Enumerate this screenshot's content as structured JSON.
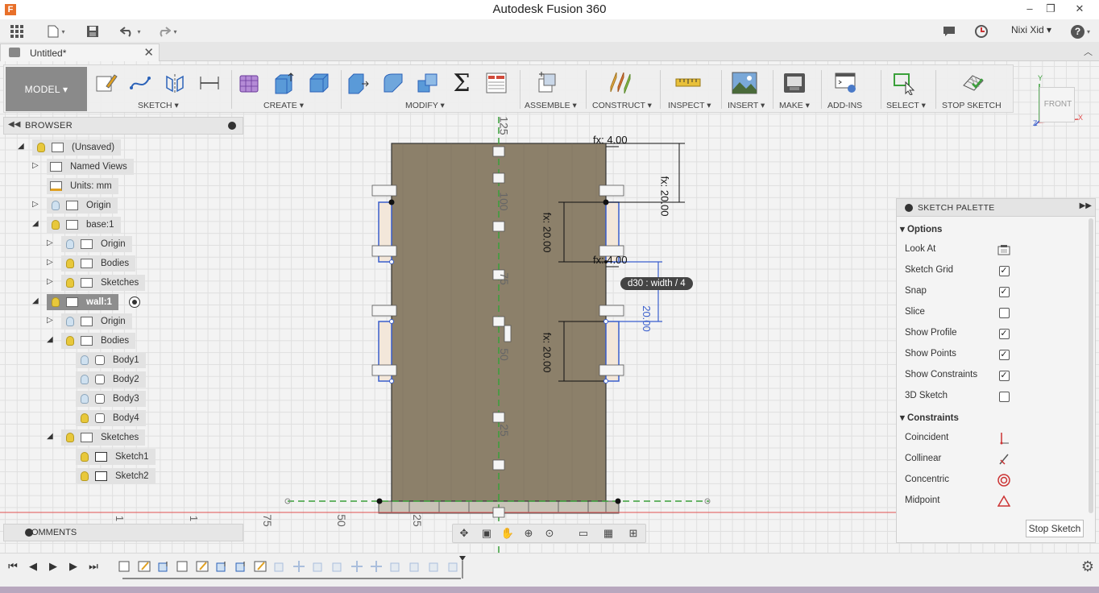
{
  "window": {
    "title": "Autodesk Fusion 360",
    "app_icon": "F",
    "minimize": "–",
    "maximize": "❐",
    "close": "✕"
  },
  "quick_access": {
    "grid_icon": "data-panel-icon",
    "file_icon": "file-icon",
    "save_icon": "save-icon",
    "undo_icon": "undo-icon",
    "redo_icon": "redo-icon",
    "user_name": "Nixi Xid",
    "caret": "▾",
    "help": "?"
  },
  "document_tab": {
    "label": "Untitled*",
    "close": "✕"
  },
  "toolbar": {
    "workspace": "MODEL ▾",
    "groups": [
      {
        "label": "SKETCH ▾"
      },
      {
        "label": "CREATE ▾"
      },
      {
        "label": "MODIFY ▾"
      },
      {
        "label": "ASSEMBLE ▾"
      },
      {
        "label": "CONSTRUCT ▾"
      },
      {
        "label": "INSPECT ▾"
      },
      {
        "label": "INSERT ▾"
      },
      {
        "label": "MAKE ▾"
      },
      {
        "label": "ADD-INS"
      },
      {
        "label": "SELECT ▾"
      },
      {
        "label": "STOP SKETCH"
      }
    ],
    "sigma": "Σ"
  },
  "view_cube": {
    "face": "FRONT",
    "axis_y": "Y",
    "axis_x": "X",
    "axis_z": "Z"
  },
  "browser": {
    "title": "BROWSER",
    "items": [
      {
        "label": "(Unsaved)"
      },
      {
        "label": "Named Views"
      },
      {
        "label": "Units: mm"
      },
      {
        "label": "Origin"
      },
      {
        "label": "base:1"
      },
      {
        "label": "Origin"
      },
      {
        "label": "Bodies"
      },
      {
        "label": "Sketches"
      },
      {
        "label": "wall:1"
      },
      {
        "label": "Origin"
      },
      {
        "label": "Bodies"
      },
      {
        "label": "Body1"
      },
      {
        "label": "Body2"
      },
      {
        "label": "Body3"
      },
      {
        "label": "Body4"
      },
      {
        "label": "Sketches"
      },
      {
        "label": "Sketch1"
      },
      {
        "label": "Sketch2"
      }
    ]
  },
  "comments": {
    "title": "COMMENTS"
  },
  "canvas": {
    "ruler_vertical": [
      "125",
      "100",
      "75",
      "50",
      "25"
    ],
    "ruler_horizontal": [
      "75",
      "50",
      "25"
    ],
    "dimensions": [
      "fx: 4.00",
      "fx: 20.00",
      "fx: 20.00",
      "fx: 4.00",
      "20.00",
      "fx: 20.00"
    ],
    "tooltip": "d30 : width / 4",
    "fill_color": "#8c806a",
    "sketch_line_color": "#3a5fcd",
    "axis_color": "#3aa03a",
    "ruler_1_a": "1",
    "ruler_1_b": "1"
  },
  "sketch_palette": {
    "title": "SKETCH PALETTE",
    "options_header": "Options",
    "options": [
      {
        "label": "Look At",
        "type": "button"
      },
      {
        "label": "Sketch Grid",
        "checked": true
      },
      {
        "label": "Snap",
        "checked": true
      },
      {
        "label": "Slice",
        "checked": false
      },
      {
        "label": "Show Profile",
        "checked": true
      },
      {
        "label": "Show Points",
        "checked": true
      },
      {
        "label": "Show Constraints",
        "checked": true
      },
      {
        "label": "3D Sketch",
        "checked": false
      }
    ],
    "constraints_header": "Constraints",
    "constraints": [
      {
        "label": "Coincident",
        "icon": "coincident-icon"
      },
      {
        "label": "Collinear",
        "icon": "collinear-icon"
      },
      {
        "label": "Concentric",
        "icon": "concentric-icon"
      },
      {
        "label": "Midpoint",
        "icon": "midpoint-icon"
      }
    ],
    "stop_sketch": "Stop Sketch",
    "check": "✓"
  },
  "timeline": {
    "first": "⏮",
    "prev": "◀",
    "play": "▶",
    "next": "▶",
    "last": "⏭",
    "settings": "⚙"
  }
}
